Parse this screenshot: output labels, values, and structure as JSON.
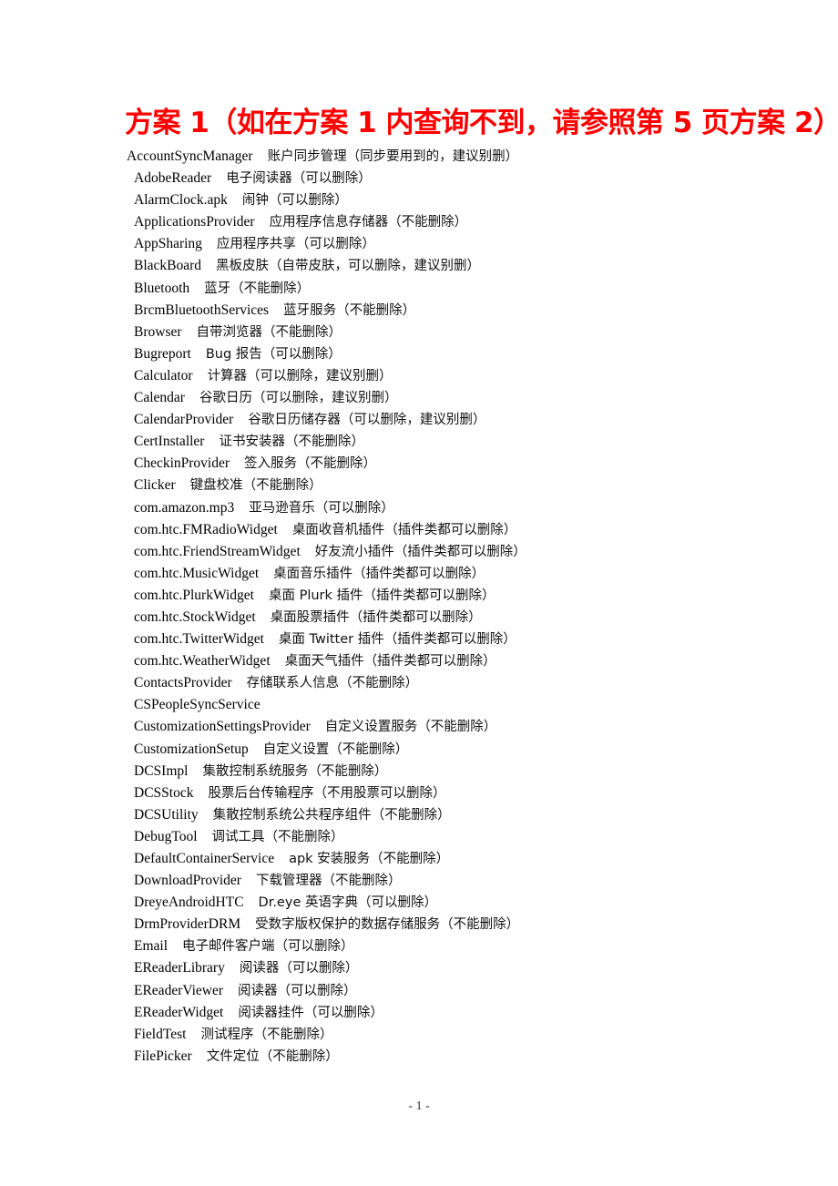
{
  "document": {
    "title": "方案 1（如在方案 1 内查询不到，请参照第 5 页方案 2）",
    "title_color": "#ff0000",
    "entries": [
      {
        "name": "AccountSyncManager",
        "desc": "账户同步管理（同步要用到的，建议别删）"
      },
      {
        "name": "AdobeReader",
        "desc": "电子阅读器（可以删除）"
      },
      {
        "name": "AlarmClock.apk",
        "desc": "闹钟（可以删除）"
      },
      {
        "name": "ApplicationsProvider",
        "desc": "应用程序信息存储器（不能删除）"
      },
      {
        "name": "AppSharing",
        "desc": "应用程序共享（可以删除）"
      },
      {
        "name": "BlackBoard",
        "desc": "黑板皮肤（自带皮肤，可以删除，建议别删）"
      },
      {
        "name": "Bluetooth",
        "desc": "蓝牙（不能删除）"
      },
      {
        "name": "BrcmBluetoothServices",
        "desc": "蓝牙服务（不能删除）"
      },
      {
        "name": "Browser",
        "desc": "自带浏览器（不能删除）"
      },
      {
        "name": "Bugreport",
        "desc": "Bug 报告（可以删除）"
      },
      {
        "name": "Calculator",
        "desc": "计算器（可以删除，建议别删）"
      },
      {
        "name": "Calendar",
        "desc": "谷歌日历（可以删除，建议别删）"
      },
      {
        "name": "CalendarProvider",
        "desc": "谷歌日历储存器（可以删除，建议别删）"
      },
      {
        "name": "CertInstaller",
        "desc": "证书安装器（不能删除）"
      },
      {
        "name": "CheckinProvider",
        "desc": "签入服务（不能删除）"
      },
      {
        "name": "Clicker",
        "desc": "键盘校准（不能删除）"
      },
      {
        "name": "com.amazon.mp3",
        "desc": "亚马逊音乐（可以删除）"
      },
      {
        "name": "com.htc.FMRadioWidget",
        "desc": "桌面收音机插件（插件类都可以删除）"
      },
      {
        "name": "com.htc.FriendStreamWidget",
        "desc": "好友流小插件（插件类都可以删除）"
      },
      {
        "name": "com.htc.MusicWidget",
        "desc": "桌面音乐插件（插件类都可以删除）"
      },
      {
        "name": "com.htc.PlurkWidget",
        "desc": "桌面 Plurk 插件（插件类都可以删除）"
      },
      {
        "name": "com.htc.StockWidget",
        "desc": "桌面股票插件（插件类都可以删除）"
      },
      {
        "name": "com.htc.TwitterWidget",
        "desc": "桌面 Twitter 插件（插件类都可以删除）"
      },
      {
        "name": "com.htc.WeatherWidget",
        "desc": "桌面天气插件（插件类都可以删除）"
      },
      {
        "name": "ContactsProvider",
        "desc": "存储联系人信息（不能删除）"
      },
      {
        "name": "CSPeopleSyncService",
        "desc": ""
      },
      {
        "name": "CustomizationSettingsProvider",
        "desc": "自定义设置服务（不能删除）"
      },
      {
        "name": "CustomizationSetup",
        "desc": "自定义设置（不能删除）"
      },
      {
        "name": "DCSImpl",
        "desc": "集散控制系统服务（不能删除）"
      },
      {
        "name": "DCSStock",
        "desc": "股票后台传输程序（不用股票可以删除）"
      },
      {
        "name": "DCSUtility",
        "desc": "集散控制系统公共程序组件（不能删除）"
      },
      {
        "name": "DebugTool",
        "desc": "调试工具（不能删除）"
      },
      {
        "name": "DefaultContainerService",
        "desc": "apk 安装服务（不能删除）"
      },
      {
        "name": "DownloadProvider",
        "desc": "下载管理器（不能删除）"
      },
      {
        "name": "DreyeAndroidHTC",
        "desc": "Dr.eye 英语字典（可以删除）"
      },
      {
        "name": "DrmProviderDRM",
        "desc": "受数字版权保护的数据存储服务（不能删除）"
      },
      {
        "name": "Email",
        "desc": "电子邮件客户端（可以删除）"
      },
      {
        "name": "EReaderLibrary",
        "desc": "阅读器（可以删除）"
      },
      {
        "name": "EReaderViewer",
        "desc": "阅读器（可以删除）"
      },
      {
        "name": "EReaderWidget",
        "desc": "阅读器挂件（可以删除）"
      },
      {
        "name": "FieldTest",
        "desc": "测试程序（不能删除）"
      },
      {
        "name": "FilePicker",
        "desc": "文件定位（不能删除）"
      }
    ],
    "page_number": "- 1 -"
  }
}
